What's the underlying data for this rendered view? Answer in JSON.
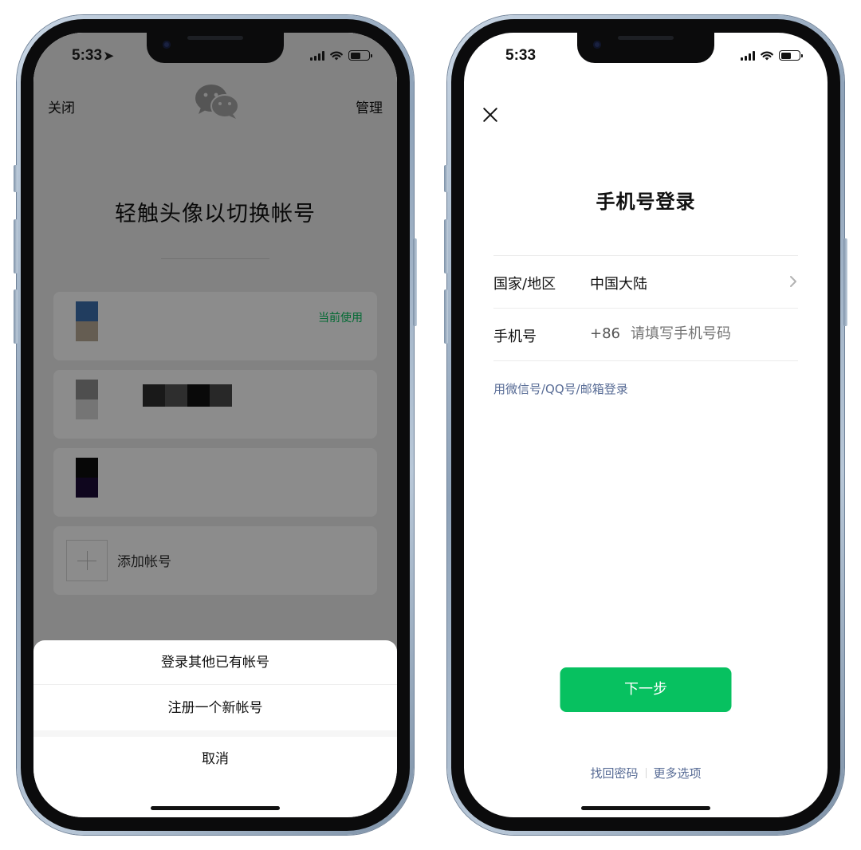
{
  "left_screen": {
    "status": {
      "time": "5:33"
    },
    "top_bar": {
      "close_label": "关闭",
      "manage_label": "管理"
    },
    "title": "轻触头像以切换帐号",
    "accounts": [
      {
        "badge": "当前使用",
        "avatar_colors": [
          "#3d6fae",
          "#b8aa96"
        ]
      },
      {
        "avatar_colors": [
          "#8e8e8e",
          "#d6d6d6"
        ],
        "name_pixel_colors": [
          "#2e2e2e",
          "#545454",
          "#111111",
          "#4a4a4a"
        ]
      },
      {
        "avatar_colors": [
          "#0d0d0d",
          "#1c0c38"
        ]
      }
    ],
    "add_account_label": "添加帐号",
    "action_sheet": {
      "login_existing": "登录其他已有帐号",
      "register_new": "注册一个新帐号",
      "cancel": "取消"
    }
  },
  "right_screen": {
    "status": {
      "time": "5:33"
    },
    "title": "手机号登录",
    "region": {
      "label": "国家/地区",
      "value": "中国大陆"
    },
    "phone": {
      "label": "手机号",
      "prefix": "+86",
      "placeholder": "请填写手机号码"
    },
    "alt_login_link": "用微信号/QQ号/邮箱登录",
    "next_button": "下一步",
    "links": {
      "recover_password": "找回密码",
      "more_options": "更多选项"
    }
  },
  "colors": {
    "accent_green": "#07c160",
    "link_blue": "#576b95"
  }
}
